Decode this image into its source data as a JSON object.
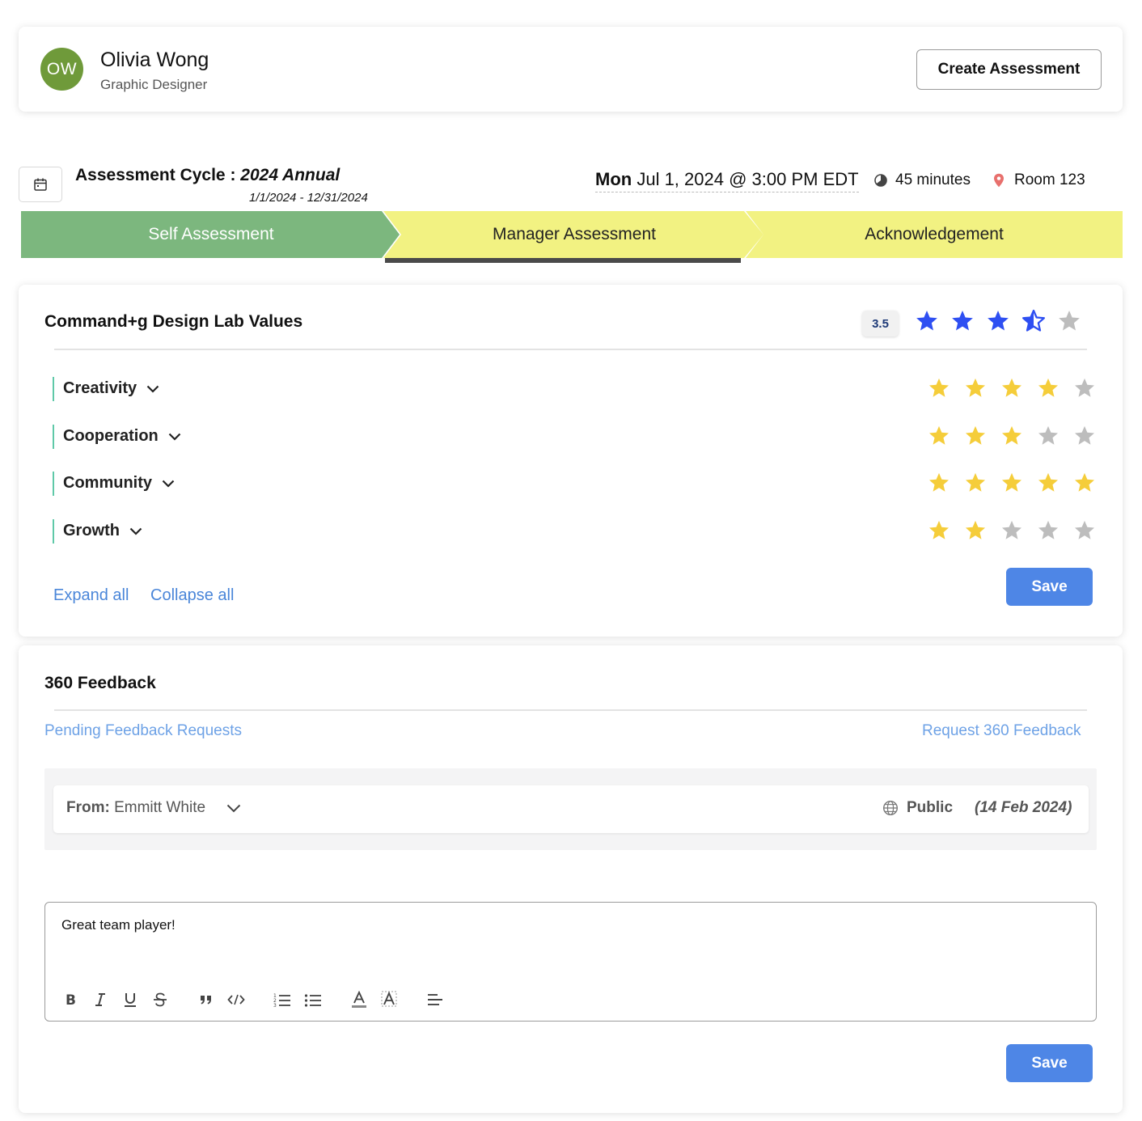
{
  "employee": {
    "initials": "OW",
    "name": "Olivia Wong",
    "role": "Graphic Designer",
    "avatar_color": "#6f9a3a"
  },
  "header": {
    "create_label": "Create Assessment"
  },
  "cycle": {
    "label": "Assessment Cycle :",
    "name": "2024 Annual",
    "range": "1/1/2024 - 12/31/2024",
    "icon": "calendar-icon"
  },
  "meeting": {
    "day": "Mon",
    "datetime": "Jul 1, 2024 @ 3:00 PM EDT",
    "duration": "45 minutes",
    "duration_icon": "clock-icon",
    "room": "Room 123",
    "room_icon": "location-pin-icon"
  },
  "stepper": {
    "steps": [
      {
        "label": "Self Assessment",
        "state": "complete",
        "color": "#7cb77e"
      },
      {
        "label": "Manager Assessment",
        "state": "current",
        "color": "#f2f282"
      },
      {
        "label": "Acknowledgement",
        "state": "upcoming",
        "color": "#f2f282"
      }
    ]
  },
  "values": {
    "title": "Command+g Design Lab Values",
    "overall_score": "3.5",
    "overall_rating": 3.5,
    "overall_star_color": "#2e4ff2",
    "items": [
      {
        "label": "Creativity",
        "rating": 4
      },
      {
        "label": "Cooperation",
        "rating": 3
      },
      {
        "label": "Community",
        "rating": 5
      },
      {
        "label": "Growth",
        "rating": 2
      }
    ],
    "star_color": "#f5cd3a",
    "empty_star_color": "#bdbdbd",
    "expand_label": "Expand all",
    "collapse_label": "Collapse all",
    "save_label": "Save"
  },
  "feedback": {
    "title": "360 Feedback",
    "pending_label": "Pending Feedback Requests",
    "request_label": "Request 360 Feedback",
    "entry": {
      "from_label": "From:",
      "from_name": "Emmitt White",
      "visibility": "Public",
      "visibility_icon": "globe-icon",
      "date": "(14 Feb 2024)"
    },
    "editor_text": "Great team player!",
    "toolbar": [
      "bold-icon",
      "italic-icon",
      "underline-icon",
      "strikethrough-icon",
      "quote-icon",
      "code-icon",
      "ordered-list-icon",
      "bullet-list-icon",
      "text-color-icon",
      "highlight-icon",
      "align-icon"
    ],
    "save_label": "Save"
  }
}
